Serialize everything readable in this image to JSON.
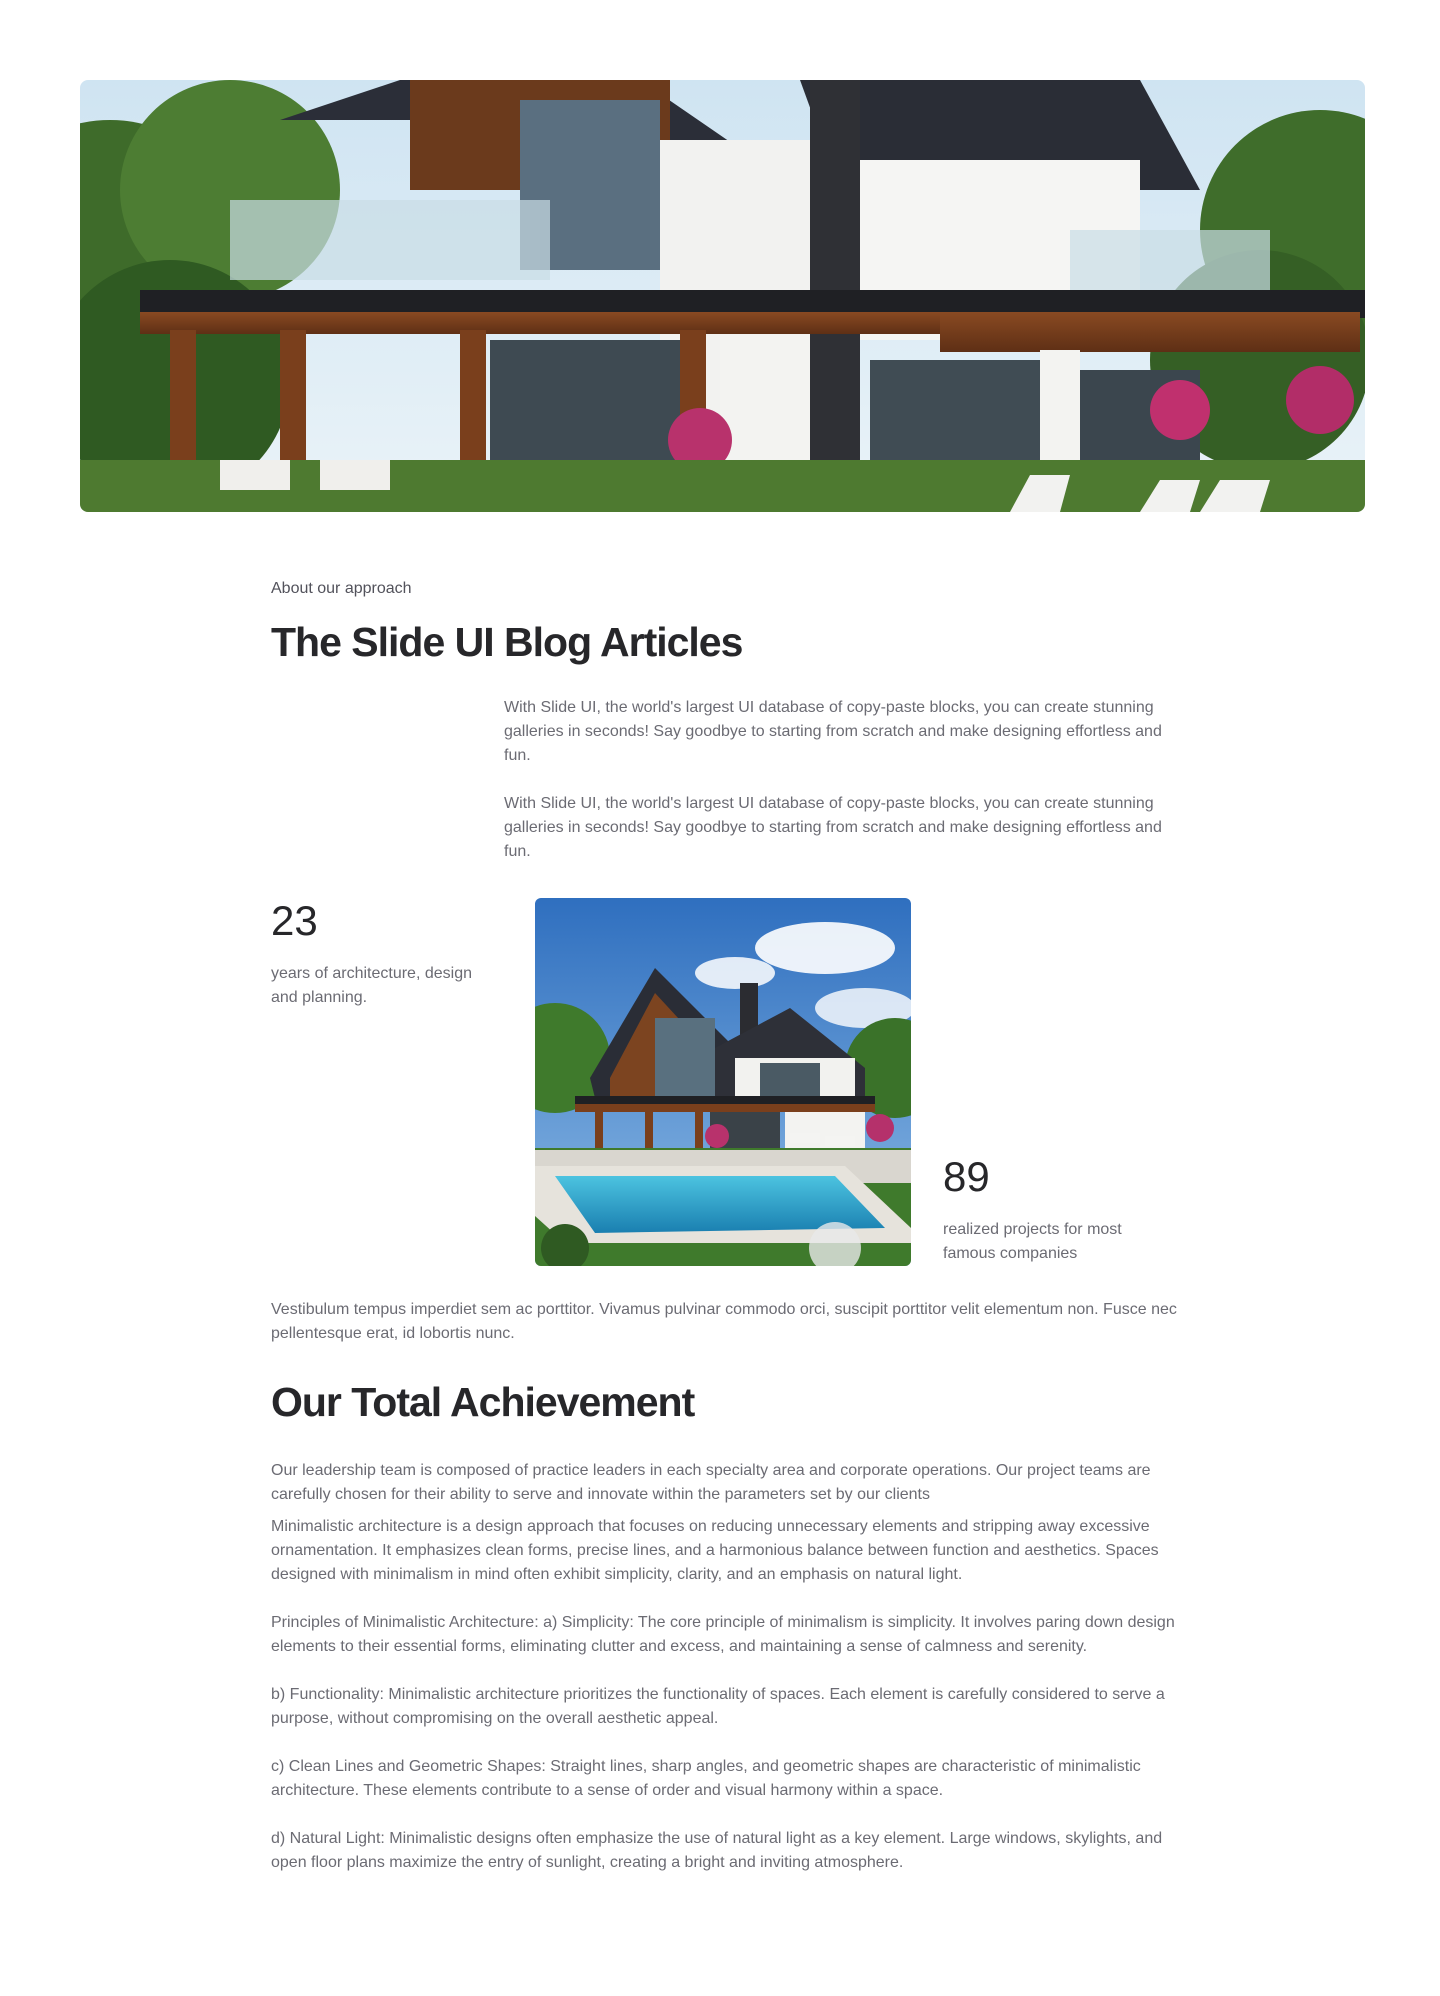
{
  "hero": {
    "image": "modern-house-photo"
  },
  "article": {
    "eyebrow": "About our approach",
    "title": "The Slide UI Blog Articles",
    "intro": [
      "With Slide UI, the world's largest UI database of copy-paste blocks, you can create stunning galleries in seconds! Say goodbye to starting from scratch and make designing effortless and fun.",
      "With Slide UI, the world's largest UI database of copy-paste blocks, you can create stunning galleries in seconds! Say goodbye to starting from scratch and make designing effortless and fun."
    ],
    "stats": [
      {
        "value": "23",
        "label": "years of architecture, design and planning."
      },
      {
        "value": "89",
        "label": "realized projects for most famous companies"
      }
    ],
    "middle_image": "house-with-pool-photo",
    "paragraph_after_stats": "Vestibulum tempus imperdiet sem ac porttitor. Vivamus pulvinar commodo orci, suscipit porttitor velit elementum non. Fusce nec pellentesque erat, id lobortis nunc.",
    "achievement_title": "Our Total Achievement",
    "achievement_intro": "Our leadership team is composed of practice leaders in each specialty area and corporate operations. Our project teams are carefully chosen for their ability to serve and innovate within the parameters set by our clients",
    "body": [
      "Minimalistic architecture is a design approach that focuses on reducing unnecessary elements and stripping away excessive ornamentation. It emphasizes clean forms, precise lines, and a harmonious balance between function and aesthetics. Spaces designed with minimalism in mind often exhibit simplicity, clarity, and an emphasis on natural light.",
      "Principles of Minimalistic Architecture: a) Simplicity: The core principle of minimalism is simplicity. It involves paring down design elements to their essential forms, eliminating clutter and excess, and maintaining a sense of calmness and serenity.",
      "b) Functionality: Minimalistic architecture prioritizes the functionality of spaces. Each element is carefully considered to serve a purpose, without compromising on the overall aesthetic appeal.",
      "c) Clean Lines and Geometric Shapes: Straight lines, sharp angles, and geometric shapes are characteristic of minimalistic architecture. These elements contribute to a sense of order and visual harmony within a space.",
      "d) Natural Light: Minimalistic designs often emphasize the use of natural light as a key element. Large windows, skylights, and open floor plans maximize the entry of sunlight, creating a bright and inviting atmosphere."
    ]
  },
  "colors": {
    "heading": "#27272a",
    "body_text": "#6b6b73",
    "background": "#ffffff"
  }
}
